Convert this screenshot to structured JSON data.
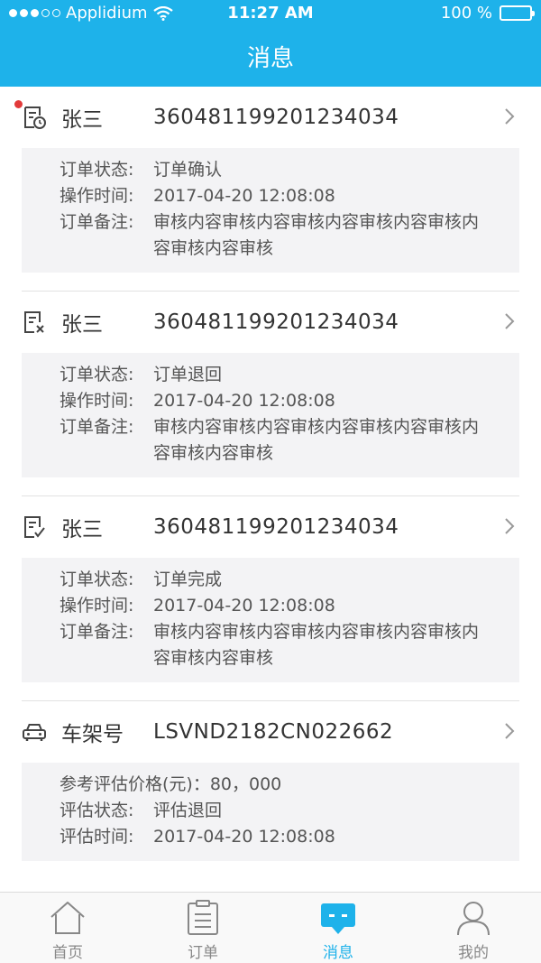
{
  "status_bar": {
    "carrier": "Applidium",
    "time": "11:27 AM",
    "battery": "100 %"
  },
  "nav": {
    "title": "消息"
  },
  "messages": [
    {
      "icon": "order-clock-icon",
      "unread": true,
      "name": "张三",
      "number": "360481199201234034",
      "rows": [
        {
          "label": "订单状态:",
          "value": "订单确认"
        },
        {
          "label": "操作时间:",
          "value": "2017-04-20 12:08:08"
        },
        {
          "label": "订单备注:",
          "value": "审核内容审核内容审核内容审核内容审核内容审核内容审核"
        }
      ]
    },
    {
      "icon": "order-returned-icon",
      "unread": false,
      "name": "张三",
      "number": "360481199201234034",
      "rows": [
        {
          "label": "订单状态:",
          "value": "订单退回"
        },
        {
          "label": "操作时间:",
          "value": "2017-04-20 12:08:08"
        },
        {
          "label": "订单备注:",
          "value": "审核内容审核内容审核内容审核内容审核内容审核内容审核"
        }
      ]
    },
    {
      "icon": "order-complete-icon",
      "unread": false,
      "name": "张三",
      "number": "360481199201234034",
      "rows": [
        {
          "label": "订单状态:",
          "value": "订单完成"
        },
        {
          "label": "操作时间:",
          "value": "2017-04-20 12:08:08"
        },
        {
          "label": "订单备注:",
          "value": "审核内容审核内容审核内容审核内容审核内容审核内容审核"
        }
      ]
    },
    {
      "icon": "car-icon",
      "unread": false,
      "name": "车架号",
      "number": "LSVND2182CN022662",
      "rows": [
        {
          "text": "参考评估价格(元)：80，000"
        },
        {
          "label": "评估状态:",
          "value": "评估退回"
        },
        {
          "label": "评估时间:",
          "value": "2017-04-20 12:08:08"
        }
      ]
    }
  ],
  "tabbar": {
    "active": "消息",
    "items": [
      {
        "label": "首页",
        "icon": "home-icon"
      },
      {
        "label": "订单",
        "icon": "clipboard-icon"
      },
      {
        "label": "消息",
        "icon": "message-icon"
      },
      {
        "label": "我的",
        "icon": "person-icon"
      }
    ]
  },
  "colors": {
    "accent": "#1eb2ea",
    "unread_dot": "#e23a3a",
    "detail_bg": "#f3f3f5"
  }
}
